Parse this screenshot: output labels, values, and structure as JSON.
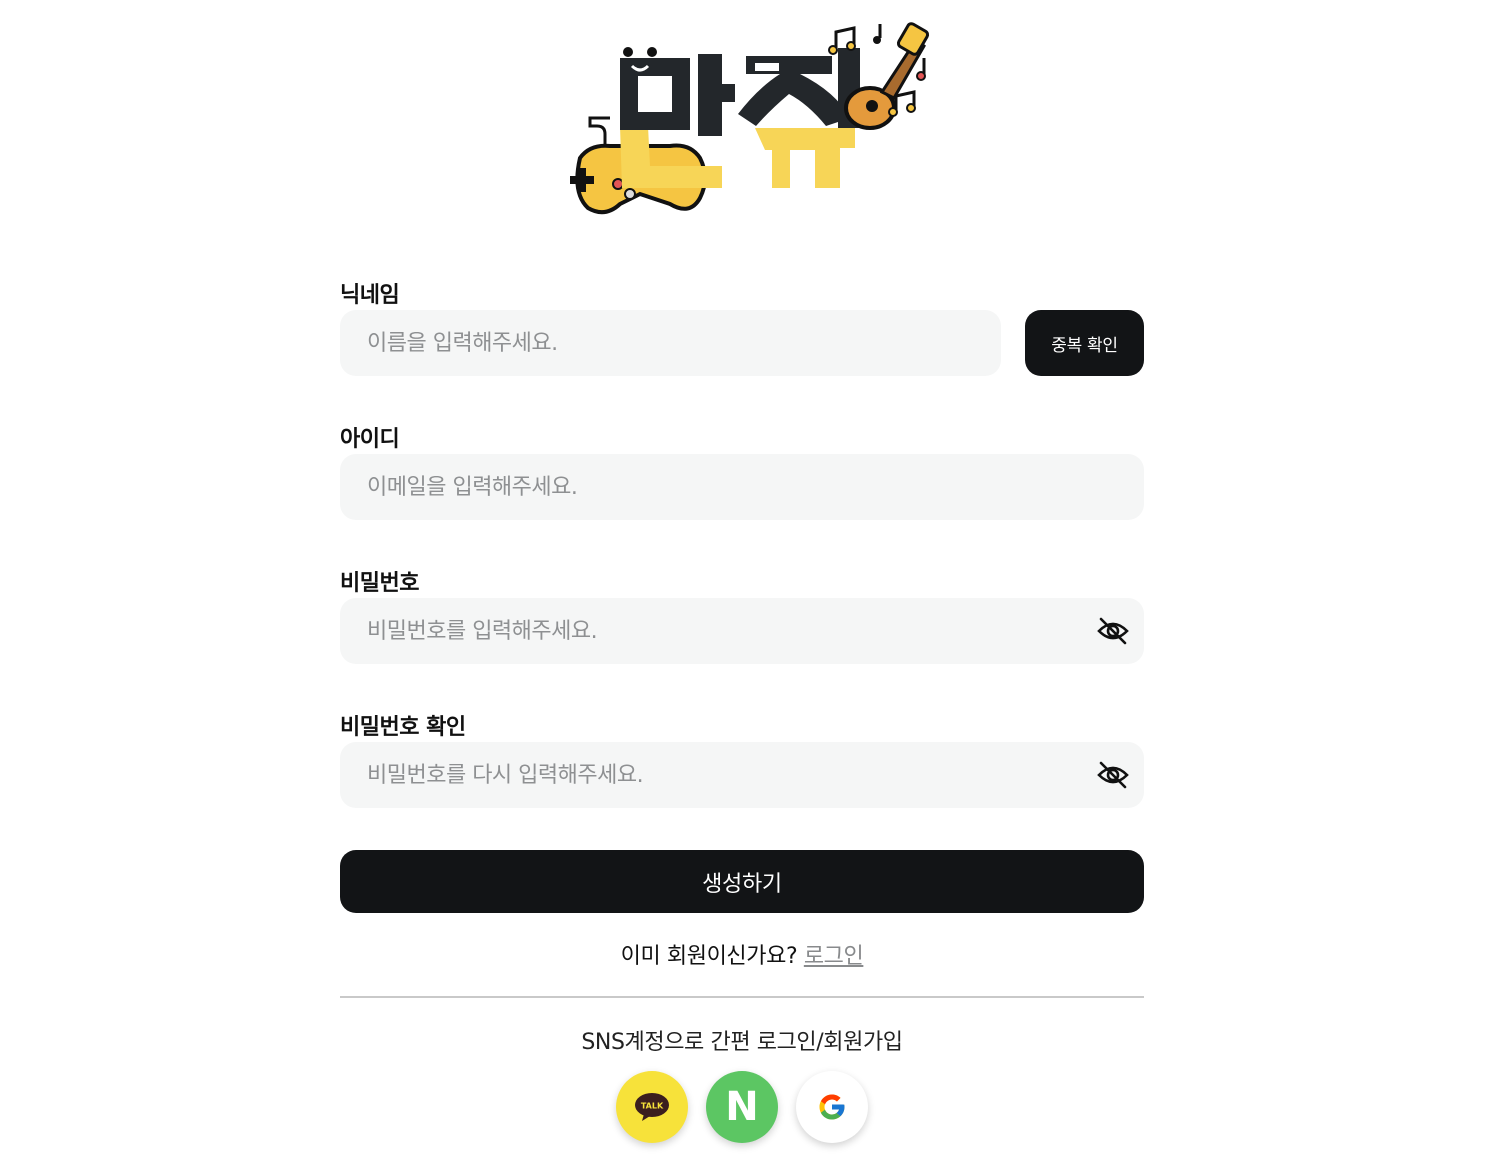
{
  "logo": {
    "text": "만취",
    "alt": "만취 logo with game controller and guitar"
  },
  "form": {
    "nickname": {
      "label": "닉네임",
      "placeholder": "이름을 입력해주세요.",
      "value": "",
      "check_button": "중복 확인"
    },
    "userid": {
      "label": "아이디",
      "placeholder": "이메일을 입력해주세요.",
      "value": ""
    },
    "password": {
      "label": "비밀번호",
      "placeholder": "비밀번호를 입력해주세요.",
      "value": "",
      "toggle_icon": "eye-off-icon"
    },
    "password_confirm": {
      "label": "비밀번호 확인",
      "placeholder": "비밀번호를 다시 입력해주세요.",
      "value": "",
      "toggle_icon": "eye-off-icon"
    },
    "submit_label": "생성하기"
  },
  "login_prompt": {
    "text": "이미 회원이신가요?",
    "link": "로그인"
  },
  "sns": {
    "title": "SNS계정으로 간편 로그인/회원가입",
    "providers": [
      {
        "name": "kakao",
        "icon": "kakao-talk-icon",
        "badge": "TALK",
        "color": "#f7e23a"
      },
      {
        "name": "naver",
        "icon": "naver-icon",
        "badge": "N",
        "color": "#5cc663"
      },
      {
        "name": "google",
        "icon": "google-icon",
        "color": "#ffffff"
      }
    ]
  }
}
